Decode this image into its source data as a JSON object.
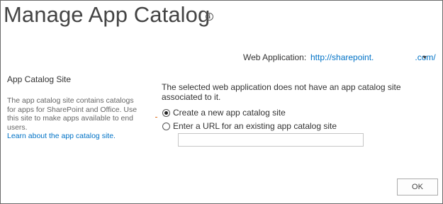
{
  "page": {
    "title": "Manage App Catalog"
  },
  "web_application": {
    "label": "Web Application:",
    "url_prefix": "http://sharepoint.",
    "url_suffix": ".com/"
  },
  "section": {
    "heading": "App Catalog Site",
    "description": "The app catalog site contains catalogs for apps for SharePoint and Office. Use this site to make apps available to end users.",
    "learn_link": "Learn about the app catalog site."
  },
  "main": {
    "notice": "The selected web application does not have an app catalog site associated to it.",
    "options": [
      {
        "label": "Create a new app catalog site",
        "checked": true
      },
      {
        "label": "Enter a URL for an existing app catalog site",
        "checked": false
      }
    ],
    "url_input_value": ""
  },
  "buttons": {
    "ok_label": "OK"
  },
  "colors": {
    "link": "#0072c6",
    "text": "#444444",
    "border": "#6b6b6b"
  }
}
